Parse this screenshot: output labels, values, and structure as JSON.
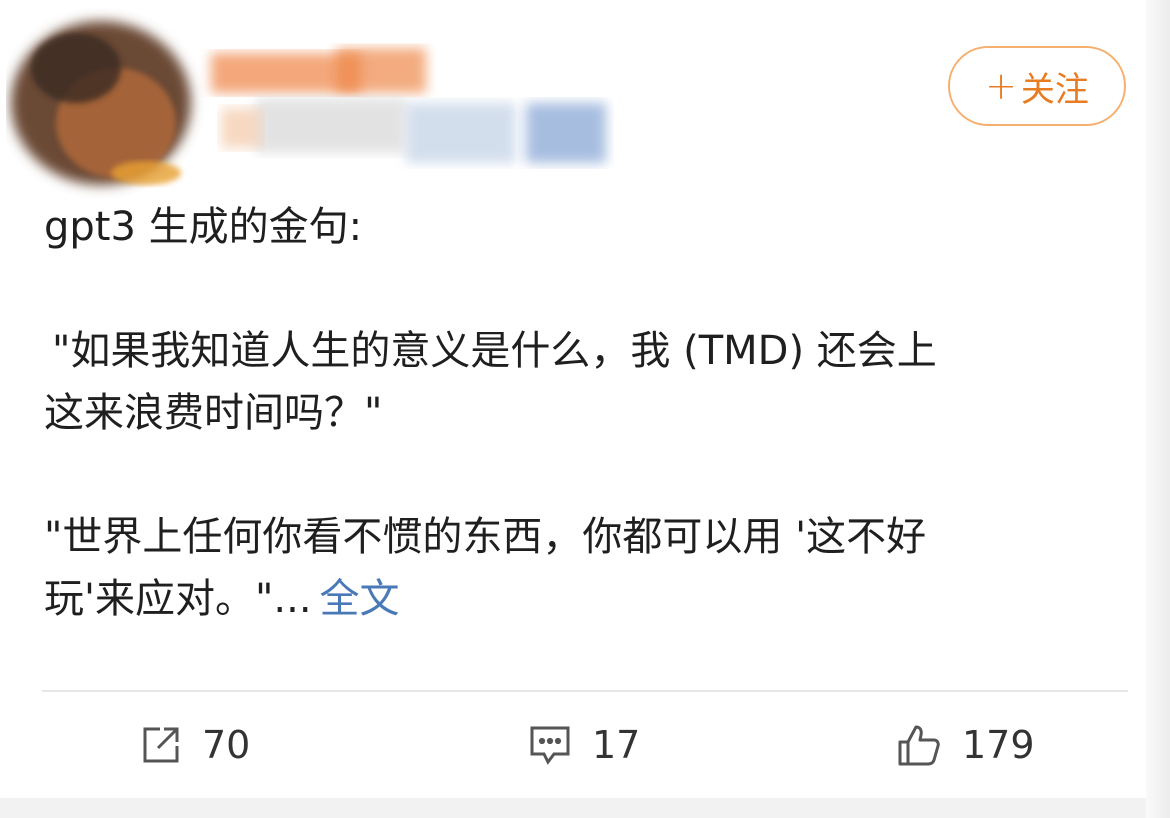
{
  "header": {
    "follow_label": "关注",
    "follow_plus": "+",
    "follow_color": "#e87c22"
  },
  "post": {
    "line1": "gpt3 生成的金句:",
    "quote1_line1": "\"如果我知道人生的意义是什么，我 (TMD) 还会上",
    "quote1_line2": "这来浪费时间吗？\"",
    "quote2_line1": "\"世界上任何你看不惯的东西，你都可以用 '这不好",
    "quote2_line2": "玩'来应对。\"...",
    "full_text_link": "全文",
    "link_color": "#4a79b8"
  },
  "actions": {
    "repost_count": "70",
    "comment_count": "17",
    "like_count": "179"
  },
  "icons": {
    "repost": "share-icon",
    "comment": "comment-icon",
    "like": "thumbs-up-icon"
  }
}
